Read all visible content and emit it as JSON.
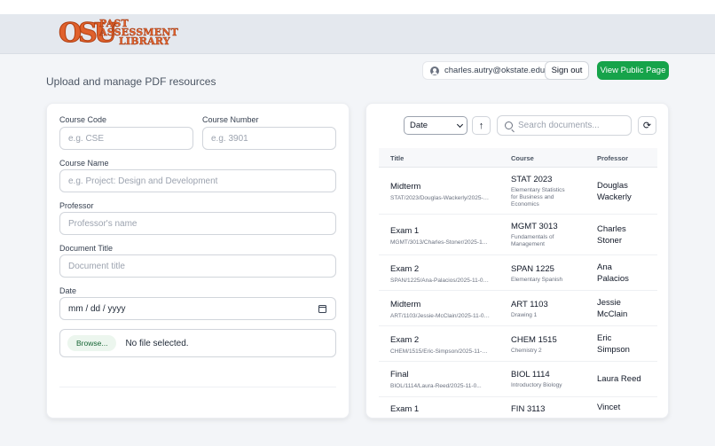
{
  "logo": {
    "mark": "OSU",
    "lines": [
      "PAST",
      "ASSESSMENT",
      "LIBRARY"
    ]
  },
  "page": {
    "subtitle": "Upload and manage PDF resources"
  },
  "header": {
    "user_email": "charles.autry@okstate.edu",
    "sign_out": "Sign out",
    "view_public": "View Public Page",
    "accent_color": "#16a34a",
    "brand_color": "#e0612c"
  },
  "form": {
    "course_code": {
      "label": "Course Code",
      "placeholder": "e.g. CSE"
    },
    "course_number": {
      "label": "Course Number",
      "placeholder": "e.g. 3901"
    },
    "course_name": {
      "label": "Course Name",
      "placeholder": "e.g. Project: Design and Development"
    },
    "professor": {
      "label": "Professor",
      "placeholder": "Professor's name"
    },
    "document_title": {
      "label": "Document Title",
      "placeholder": "Document title"
    },
    "date": {
      "label": "Date",
      "value": "mm / dd / yyyy"
    },
    "file": {
      "browse": "Browse...",
      "status": "No file selected."
    }
  },
  "list": {
    "sort_value": "Date",
    "search_placeholder": "Search documents...",
    "sort_icon": "arrow-up-icon",
    "refresh_icon": "refresh-icon",
    "columns": [
      "Title",
      "Course",
      "Professor"
    ],
    "rows": [
      {
        "title": "Midterm",
        "path": "STAT/2023/Douglas-Wackerly/2025-11-02.pdf",
        "code": "STAT 2023",
        "course": "Elementary Statistics for Business and Economics",
        "prof1": "Douglas",
        "prof2": "Wackerly"
      },
      {
        "title": "Exam 1",
        "path": "MGMT/3013/Charles-Stoner/2025-11-02.pdf",
        "code": "MGMT 3013",
        "course": "Fundamentals of Management",
        "prof1": "Charles",
        "prof2": "Stoner"
      },
      {
        "title": "Exam 2",
        "path": "SPAN/1225/Ana-Palacios/2025-11-02.pdf",
        "code": "SPAN 1225",
        "course": "Elementary Spanish",
        "prof1": "Ana",
        "prof2": "Palacios"
      },
      {
        "title": "Midterm",
        "path": "ART/1103/Jessie-McClain/2025-11-02.pdf",
        "code": "ART 1103",
        "course": "Drawing 1",
        "prof1": "Jessie",
        "prof2": "McClain"
      },
      {
        "title": "Exam 2",
        "path": "CHEM/1515/Eric-Simpson/2025-11-02.pdf",
        "code": "CHEM 1515",
        "course": "Chemistry 2",
        "prof1": "Eric",
        "prof2": "Simpson"
      },
      {
        "title": "Final",
        "path": "BIOL/1114/Laura-Reed/2025-11-0...",
        "code": "BIOL 1114",
        "course": "Introductory Biology",
        "prof1": "Laura Reed",
        "prof2": ""
      },
      {
        "title": "Exam 1",
        "path": "",
        "code": "FIN 3113",
        "course": "",
        "prof1": "Vincet",
        "prof2": ""
      }
    ]
  }
}
